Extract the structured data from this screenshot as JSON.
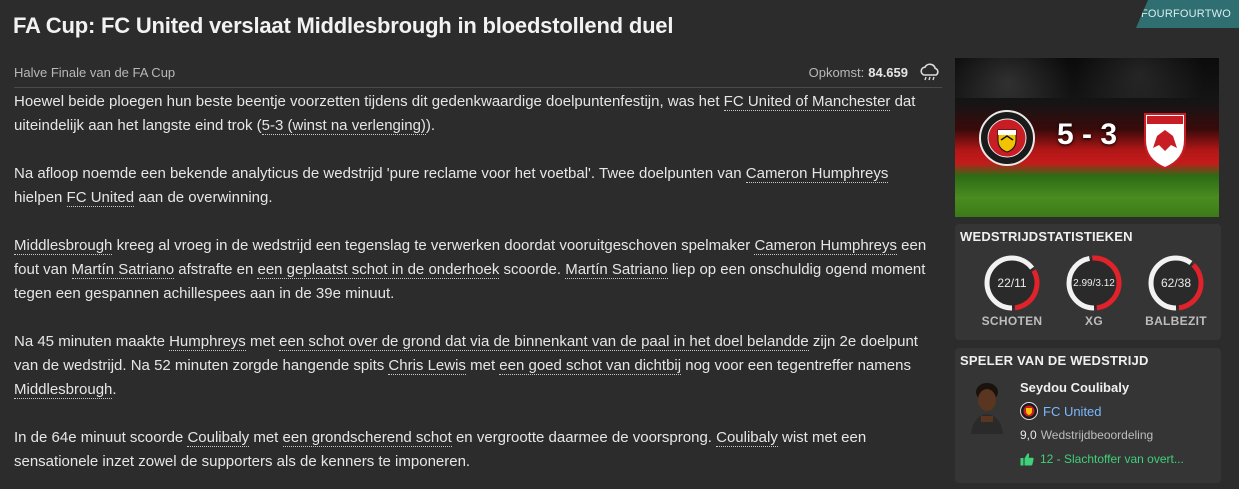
{
  "source": "FOURFOURTWO",
  "headline": "FA Cup: FC United verslaat Middlesbrough in bloedstollend duel",
  "competition": "Halve Finale van de FA Cup",
  "attendance": {
    "label": "Opkomst:",
    "value": "84.659"
  },
  "article": {
    "p1": {
      "t1": "Hoewel beide ploegen hun beste beentje voorzetten tijdens dit gedenkwaardige doelpuntenfestijn, was het ",
      "l1": "FC United of Manchester",
      "t2": " dat uiteindelijk aan het langste eind trok (",
      "l2": "5-3 (winst na verlenging)",
      "t3": ")."
    },
    "p2": {
      "t1": "Na afloop noemde een bekende analyticus de wedstrijd 'pure reclame voor het voetbal'. Twee doelpunten van ",
      "l1": "Cameron Humphreys",
      "t2": " hielpen ",
      "l2": "FC United",
      "t3": " aan de overwinning."
    },
    "p3": {
      "l1": "Middlesbrough",
      "t1": " kreeg al vroeg in de wedstrijd een tegenslag te verwerken doordat vooruitgeschoven spelmaker ",
      "l2": "Cameron Humphreys",
      "t2": " een fout van ",
      "l3": "Martín Satriano",
      "t3": " afstrafte en ",
      "l4": "een geplaatst schot in de onderhoek",
      "t4": " scoorde. ",
      "l5": "Martín Satriano",
      "t5": " liep op een onschuldig ogend moment tegen een gespannen achillespees aan in de 39e minuut."
    },
    "p4": {
      "t1": "Na 45 minuten maakte ",
      "l1": "Humphreys",
      "t2": " met ",
      "l2": "een schot over de grond dat via de binnenkant van de paal in het doel belandde",
      "t3": " zijn 2e doelpunt van de wedstrijd. Na 52 minuten zorgde hangende spits ",
      "l3": "Chris Lewis",
      "t4": " met ",
      "l4": "een goed schot van dichtbij",
      "t5": " nog voor een tegentreffer namens ",
      "l5": "Middlesbrough",
      "t6": "."
    },
    "p5": {
      "t1": "In de 64e minuut scoorde ",
      "l1": "Coulibaly",
      "t2": " met ",
      "l2": "een grondscherend schot",
      "t3": " en vergrootte daarmee de voorsprong. ",
      "l3": "Coulibaly",
      "t4": " wist met een sensationele inzet zowel de supporters als de kenners te imponeren."
    }
  },
  "score": "5 - 3",
  "stats": {
    "title": "WEDSTRIJDSTATISTIEKEN",
    "items": [
      {
        "label": "SCHOTEN",
        "value": "22/11",
        "home": 22,
        "away": 11
      },
      {
        "label": "XG",
        "value": "2.99/3.12",
        "home": 2.99,
        "away": 3.12
      },
      {
        "label": "BALBEZIT",
        "value": "62/38",
        "home": 62,
        "away": 38
      }
    ],
    "colors": {
      "home": "#f2f2f2",
      "away": "#e0232b"
    }
  },
  "motm": {
    "title": "SPELER VAN DE WEDSTRIJD",
    "name": "Seydou Coulibaly",
    "club": "FC United",
    "rating": "9,0",
    "rating_label": "Wedstrijdbeoordeling",
    "highlight": "12 - Slachtoffer van overt..."
  }
}
